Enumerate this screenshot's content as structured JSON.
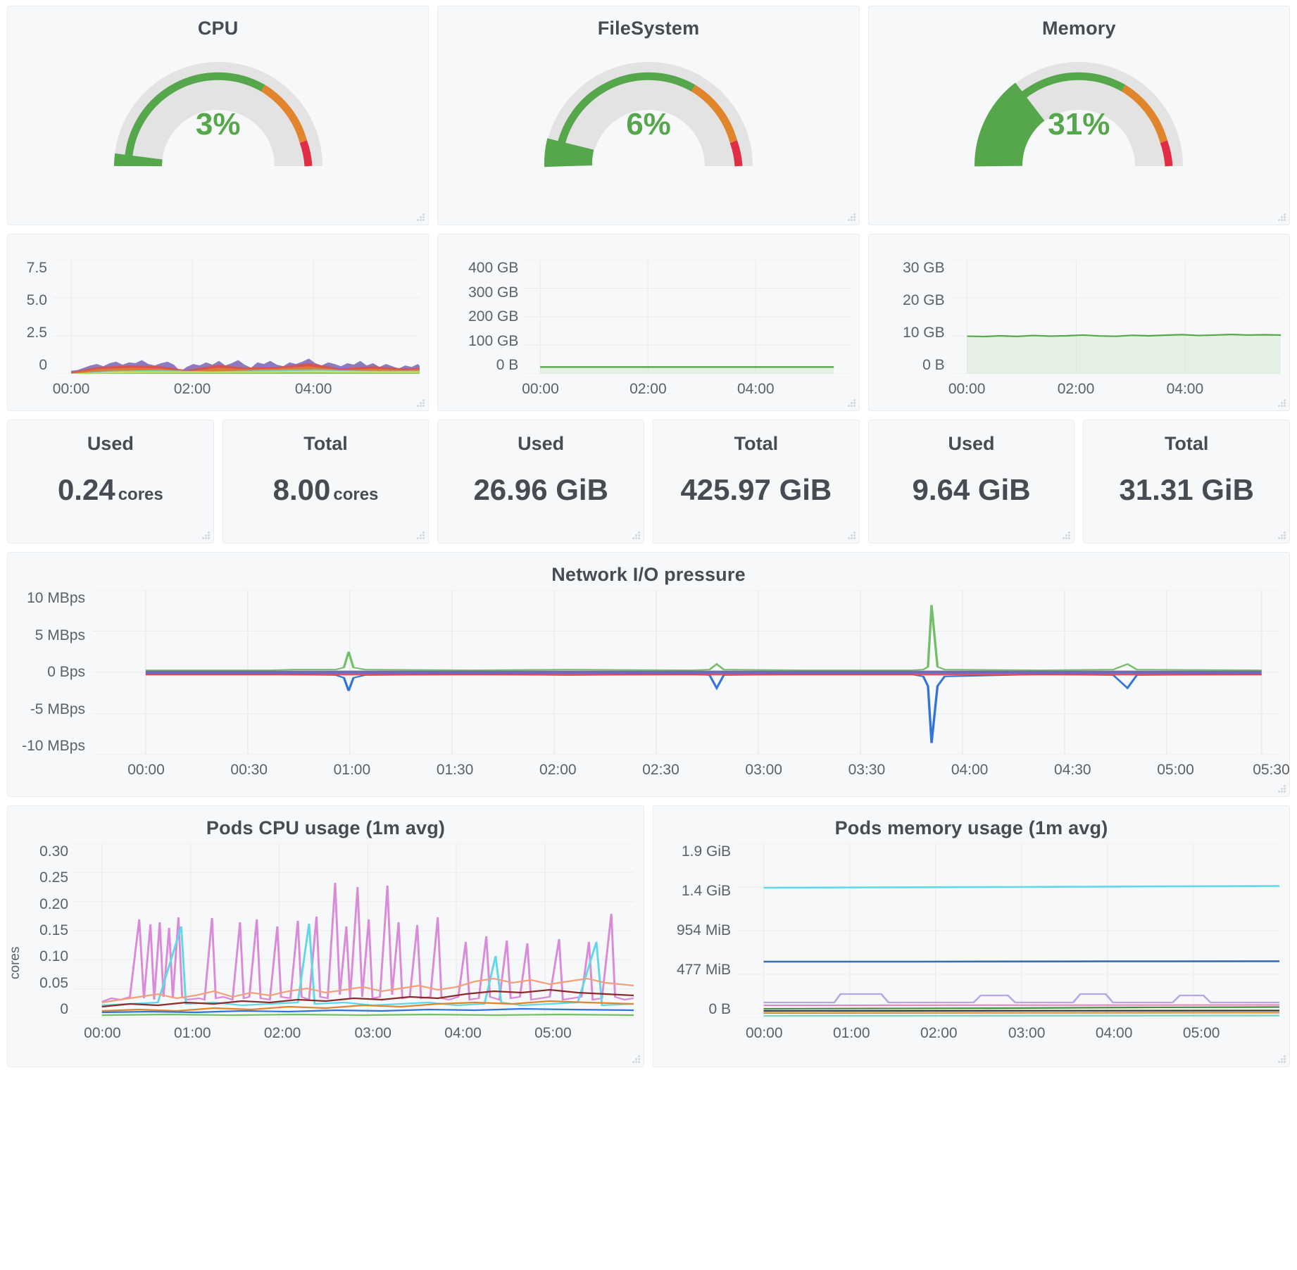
{
  "theme": {
    "panel_bg": "#f7f8f9",
    "panel_border": "#e9edf2",
    "text": "#464c54",
    "muted": "#5b6168",
    "green": "#56a64b",
    "orange": "#e0852b",
    "red": "#e02f44",
    "track": "#e3e3e3"
  },
  "gauges": [
    {
      "title": "CPU",
      "value_label": "3%",
      "percent": 3,
      "name": "cpu"
    },
    {
      "title": "FileSystem",
      "value_label": "6%",
      "percent": 6,
      "name": "filesystem"
    },
    {
      "title": "Memory",
      "value_label": "31%",
      "percent": 31,
      "name": "memory"
    }
  ],
  "spark_charts": [
    {
      "name": "cpu-usage-timeseries",
      "chart_data": {
        "type": "area",
        "title": "",
        "xlabel": "",
        "ylabel": "",
        "ylim": [
          0,
          8.5
        ],
        "yticks": [
          "7.5",
          "5.0",
          "2.5",
          "0"
        ],
        "ytick_values": [
          7.5,
          5.0,
          2.5,
          0
        ],
        "xticks": [
          "00:00",
          "02:00",
          "04:00"
        ],
        "xtick_positions": [
          0.05,
          0.38,
          0.71
        ],
        "grid": true,
        "series": [
          {
            "name": "series-1",
            "color": "#7b64b4",
            "values": [
              0.55,
              0.5,
              0.62,
              0.78,
              0.75,
              0.68,
              0.82,
              0.9,
              0.72,
              0.86,
              0.8,
              0.95,
              0.78,
              0.72,
              0.68,
              0.8,
              0.9,
              0.75,
              0.4,
              0.62,
              0.78,
              0.7,
              0.85,
              0.72,
              0.9,
              0.68,
              0.8,
              0.95,
              0.74,
              0.6,
              0.86,
              0.78,
              0.9,
              0.72,
              0.65,
              0.82,
              0.75,
              0.88,
              1.0,
              0.8,
              0.72,
              0.86,
              0.78,
              0.68,
              0.82,
              0.74,
              0.9,
              0.72,
              0.8,
              0.66,
              0.78,
              0.7,
              0.62,
              0.74,
              0.68,
              0.8,
              0.72,
              0.64
            ]
          }
        ]
      }
    },
    {
      "name": "filesystem-usage-timeseries",
      "chart_data": {
        "type": "area",
        "title": "",
        "ylim": [
          0,
          450
        ],
        "yticks": [
          "400 GB",
          "300 GB",
          "200 GB",
          "100 GB",
          "0 B"
        ],
        "ytick_values": [
          400,
          300,
          200,
          100,
          0
        ],
        "xticks": [
          "00:00",
          "02:00",
          "04:00"
        ],
        "xtick_positions": [
          0.05,
          0.38,
          0.71
        ],
        "grid": true,
        "series": [
          {
            "name": "used",
            "color": "#73bf69",
            "values": [
              27,
              27,
              27,
              27,
              27,
              27,
              27,
              27,
              27,
              27,
              27,
              27,
              27,
              27,
              27,
              27,
              27,
              27,
              27,
              27
            ]
          }
        ]
      }
    },
    {
      "name": "memory-usage-timeseries",
      "chart_data": {
        "type": "area",
        "title": "",
        "ylim": [
          0,
          34
        ],
        "yticks": [
          "30 GB",
          "20 GB",
          "10 GB",
          "0 B"
        ],
        "ytick_values": [
          30,
          20,
          10,
          0
        ],
        "xticks": [
          "00:00",
          "02:00",
          "04:00"
        ],
        "xtick_positions": [
          0.05,
          0.38,
          0.71
        ],
        "grid": true,
        "series": [
          {
            "name": "used",
            "color": "#73bf69",
            "values": [
              10.1,
              10.0,
              10.2,
              10.1,
              10.3,
              10.1,
              10.2,
              10.4,
              10.2,
              10.1,
              10.3,
              10.2,
              10.1,
              10.3,
              10.5,
              10.2,
              10.3,
              10.4,
              10.6,
              10.3,
              10.4,
              10.5,
              10.3,
              10.4
            ]
          }
        ]
      }
    }
  ],
  "stats": [
    {
      "name": "cpu-used",
      "label": "Used",
      "value": "0.24",
      "unit": "cores"
    },
    {
      "name": "cpu-total",
      "label": "Total",
      "value": "8.00",
      "unit": "cores"
    },
    {
      "name": "filesystem-used",
      "label": "Used",
      "value": "26.96",
      "unit": "GiB"
    },
    {
      "name": "filesystem-total",
      "label": "Total",
      "value": "425.97",
      "unit": "GiB"
    },
    {
      "name": "memory-used",
      "label": "Used",
      "value": "9.64",
      "unit": "GiB"
    },
    {
      "name": "memory-total",
      "label": "Total",
      "value": "31.31",
      "unit": "GiB"
    }
  ],
  "network": {
    "name": "network-io-pressure",
    "chart_data": {
      "type": "line",
      "title": "Network I/O pressure",
      "xlabel": "",
      "ylabel": "",
      "ylim": [
        -10,
        10
      ],
      "yticks": [
        "10 MBps",
        "5 MBps",
        "0 Bps",
        "-5 MBps",
        "-10 MBps"
      ],
      "ytick_values": [
        10,
        5,
        0,
        -5,
        -10
      ],
      "xticks": [
        "00:00",
        "00:30",
        "01:00",
        "01:30",
        "02:00",
        "02:30",
        "03:00",
        "03:30",
        "04:00",
        "04:30",
        "05:00",
        "05:30"
      ],
      "grid": true,
      "legend": "none",
      "series": [
        {
          "name": "received",
          "color": "#73bf69",
          "spikes": [
            {
              "x": 0.175,
              "y": 1.1
            },
            {
              "x": 0.525,
              "y": 1.3
            },
            {
              "x": 0.705,
              "y": 8.2
            },
            {
              "x": 0.875,
              "y": 1.4
            }
          ]
        },
        {
          "name": "transmitted",
          "color": "#3274d9",
          "spikes": [
            {
              "x": 0.178,
              "y": -1.7
            },
            {
              "x": 0.528,
              "y": -1.6
            },
            {
              "x": 0.707,
              "y": -8.6
            },
            {
              "x": 0.877,
              "y": -1.7
            }
          ]
        },
        {
          "name": "baseline-purple",
          "color": "#7b64b4",
          "spikes": []
        },
        {
          "name": "baseline-red",
          "color": "#e24d42",
          "spikes": []
        }
      ]
    }
  },
  "pods_cpu": {
    "name": "pods-cpu-usage",
    "chart_data": {
      "type": "line",
      "title": "Pods CPU usage (1m avg)",
      "xlabel": "",
      "ylabel": "cores",
      "ylim": [
        0,
        0.31
      ],
      "yticks": [
        "0.30",
        "0.25",
        "0.20",
        "0.15",
        "0.10",
        "0.05",
        "0"
      ],
      "ytick_values": [
        0.3,
        0.25,
        0.2,
        0.15,
        0.1,
        0.05,
        0
      ],
      "xticks": [
        "00:00",
        "01:00",
        "02:00",
        "03:00",
        "04:00",
        "05:00"
      ],
      "grid": true,
      "series": [
        {
          "name": "pod-pink",
          "color": "#d98ad9"
        },
        {
          "name": "pod-cyan",
          "color": "#5fd9e8"
        },
        {
          "name": "pod-peach",
          "color": "#f2a07b"
        },
        {
          "name": "pod-maroon",
          "color": "#8b2c2c"
        },
        {
          "name": "pod-orange",
          "color": "#e0852b"
        },
        {
          "name": "pod-blue",
          "color": "#3274d9"
        },
        {
          "name": "pod-green",
          "color": "#73bf69"
        }
      ],
      "peak_value": 0.25
    }
  },
  "pods_memory": {
    "name": "pods-memory-usage",
    "chart_data": {
      "type": "line",
      "title": "Pods memory usage (1m avg)",
      "xlabel": "",
      "ylabel": "",
      "ylim": [
        0,
        2040109466
      ],
      "yticks": [
        "1.9 GiB",
        "1.4 GiB",
        "954 MiB",
        "477 MiB",
        "0 B"
      ],
      "ytick_values": [
        1.9,
        1.4,
        0.932,
        0.466,
        0
      ],
      "xticks": [
        "00:00",
        "01:00",
        "02:00",
        "03:00",
        "04:00",
        "05:00"
      ],
      "grid": true,
      "series": [
        {
          "name": "pod-cyan",
          "color": "#5fd9e8",
          "level": 1.43
        },
        {
          "name": "pod-blue",
          "color": "#3b6ea8",
          "level": 0.6
        },
        {
          "name": "pod-violet",
          "color": "#b8a6e8",
          "level": 0.17,
          "stepped": true
        },
        {
          "name": "pod-pink",
          "color": "#e87fb8",
          "level": 0.13
        },
        {
          "name": "pod-green",
          "color": "#4b8a3f",
          "level": 0.09
        },
        {
          "name": "pod-dark",
          "color": "#2d3b2d",
          "level": 0.07
        },
        {
          "name": "pod-orange",
          "color": "#e0852b",
          "level": 0.05
        },
        {
          "name": "pod-teal",
          "color": "#7fd4c8",
          "level": 0.02
        }
      ]
    }
  }
}
